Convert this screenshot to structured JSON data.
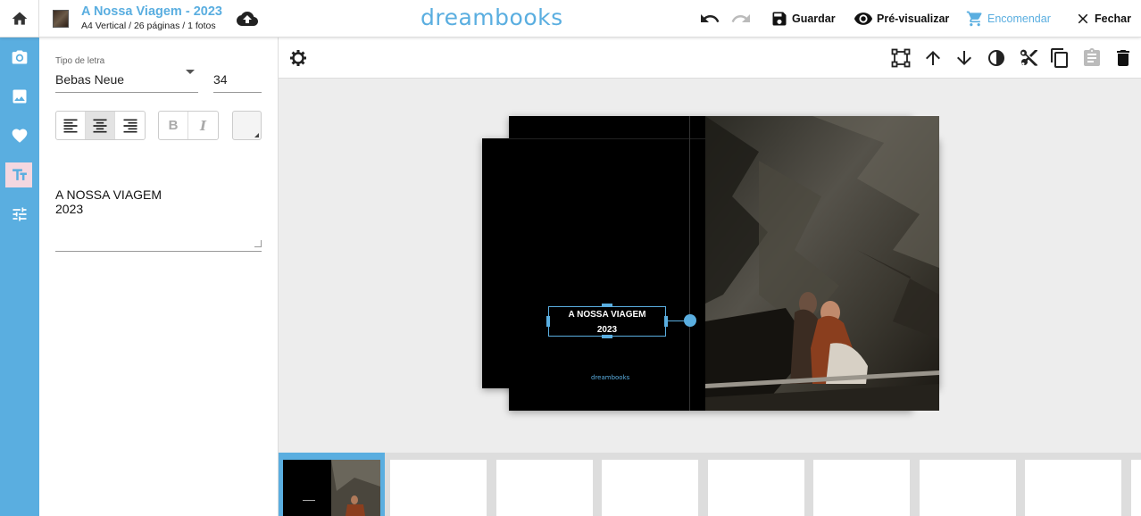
{
  "header": {
    "project_title": "A Nossa Viagem - 2023",
    "project_subtitle": "A4 Vertical / 26 páginas / 1 fotos",
    "logo": "dreambooks",
    "save_label": "Guardar",
    "preview_label": "Pré-visualizar",
    "order_label": "Encomendar",
    "close_label": "Fechar",
    "accent_color": "#5aaee0"
  },
  "sidebar": {
    "items": [
      {
        "icon": "camera-icon"
      },
      {
        "icon": "image-icon"
      },
      {
        "icon": "heart-icon"
      },
      {
        "icon": "text-icon",
        "active": true
      },
      {
        "icon": "sliders-icon"
      }
    ]
  },
  "text_panel": {
    "font_label": "Tipo de letra",
    "font_value": "Bebas Neue",
    "size_value": "34",
    "align_active": "center",
    "text_value": "A NOSSA VIAGEM\n2023"
  },
  "canvas": {
    "text_line1": "A NOSSA VIAGEM",
    "text_line2": "2023",
    "mini_logo": "dreambooks"
  },
  "thumbnails": {
    "count": 9,
    "active_index": 0
  }
}
